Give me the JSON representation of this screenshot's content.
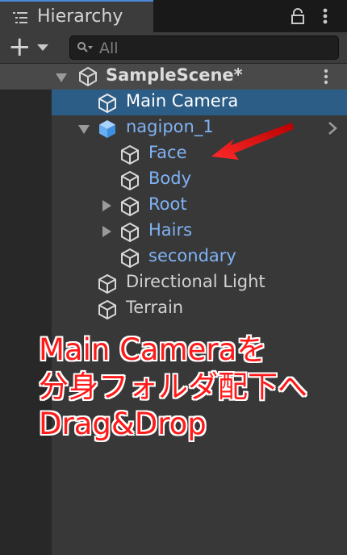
{
  "window": {
    "tab_title": "Hierarchy"
  },
  "toolbar": {
    "add_label": "+",
    "search_placeholder": "All"
  },
  "scene": {
    "name": "SampleScene*"
  },
  "tree": {
    "items": [
      {
        "label": "Main Camera",
        "selected": true,
        "type": "gameobject"
      },
      {
        "label": "nagipon_1",
        "type": "prefab",
        "expanded": true
      },
      {
        "label": "Face",
        "type": "prefab-child"
      },
      {
        "label": "Body",
        "type": "prefab-child"
      },
      {
        "label": "Root",
        "type": "prefab-child",
        "collapsed": true
      },
      {
        "label": "Hairs",
        "type": "prefab-child",
        "collapsed": true
      },
      {
        "label": "secondary",
        "type": "prefab-child"
      },
      {
        "label": "Directional Light",
        "type": "gameobject"
      },
      {
        "label": "Terrain",
        "type": "gameobject"
      }
    ]
  },
  "annotation": {
    "line1": "Main Cameraを",
    "line2": "分身フォルダ配下へ",
    "line3": "Drag&Drop",
    "color": "#ff1a1a"
  },
  "colors": {
    "selection": "#2c5d87",
    "prefab_text": "#7fb3f5",
    "tab_accent": "#4b89d8"
  }
}
